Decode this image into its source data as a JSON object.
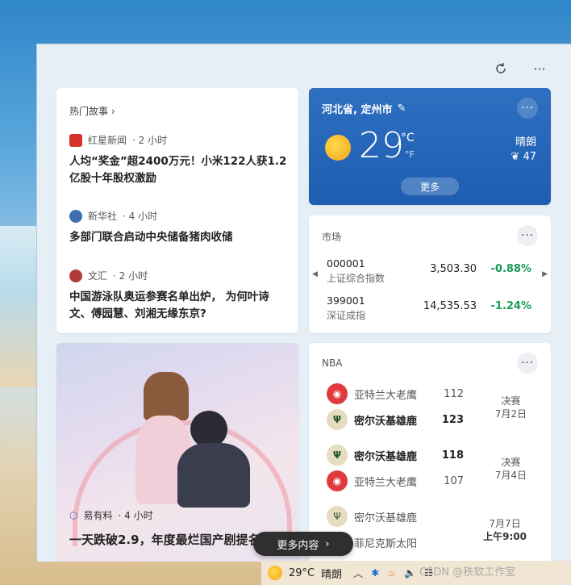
{
  "toolbar": {
    "refresh_icon": "refresh-icon",
    "more_icon": "ellipsis-icon"
  },
  "news": {
    "header": "热门故事",
    "items": [
      {
        "source": "红星新闻",
        "time": "· 2 小时",
        "title": "人均“奖金”超2400万元！小米122人获1.2亿股十年股权激励",
        "logo_color": "#d9312b"
      },
      {
        "source": "新华社",
        "time": "· 4 小时",
        "title": "多部门联合启动中央储备猪肉收储",
        "logo_color": "#3d6fb0"
      },
      {
        "source": "文汇",
        "time": "· 2 小时",
        "title": "中国游泳队奥运参赛名单出炉， 为何叶诗文、傅园慧、刘湘无缘东京?",
        "logo_color": "#b33a3a"
      }
    ]
  },
  "weather": {
    "location": "河北省, 定州市",
    "temp": "29",
    "unit_c": "°C",
    "unit_f": "°F",
    "condition": "晴朗",
    "aqi": "47",
    "more": "更多"
  },
  "market": {
    "title": "市场",
    "rows": [
      {
        "code": "000001",
        "name": "上证综合指数",
        "value": "3,503.30",
        "change": "-0.88%"
      },
      {
        "code": "399001",
        "name": "深证成指",
        "value": "14,535.53",
        "change": "-1.24%"
      }
    ]
  },
  "video": {
    "source": "易有料",
    "time": "· 4 小时",
    "title": "一天跌破2.9，年度最烂国产剧提名了"
  },
  "nba": {
    "title": "NBA",
    "games": [
      {
        "team1": "亚特兰大老鹰",
        "score1": "112",
        "team2": "密尔沃基雄鹿",
        "score2": "123",
        "stage": "决赛",
        "date": "7月2日"
      },
      {
        "team1": "密尔沃基雄鹿",
        "score1": "118",
        "team2": "亚特兰大老鹰",
        "score2": "107",
        "stage": "决赛",
        "date": "7月4日"
      },
      {
        "team1": "密尔沃基雄鹿",
        "team2": "菲尼克斯太阳",
        "date": "7月7日",
        "time": "上午9:00"
      }
    ]
  },
  "more_content": "更多内容",
  "taskbar": {
    "temp": "29°C",
    "condition": "晴朗"
  },
  "watermark": "CSDN @秩软工作室"
}
